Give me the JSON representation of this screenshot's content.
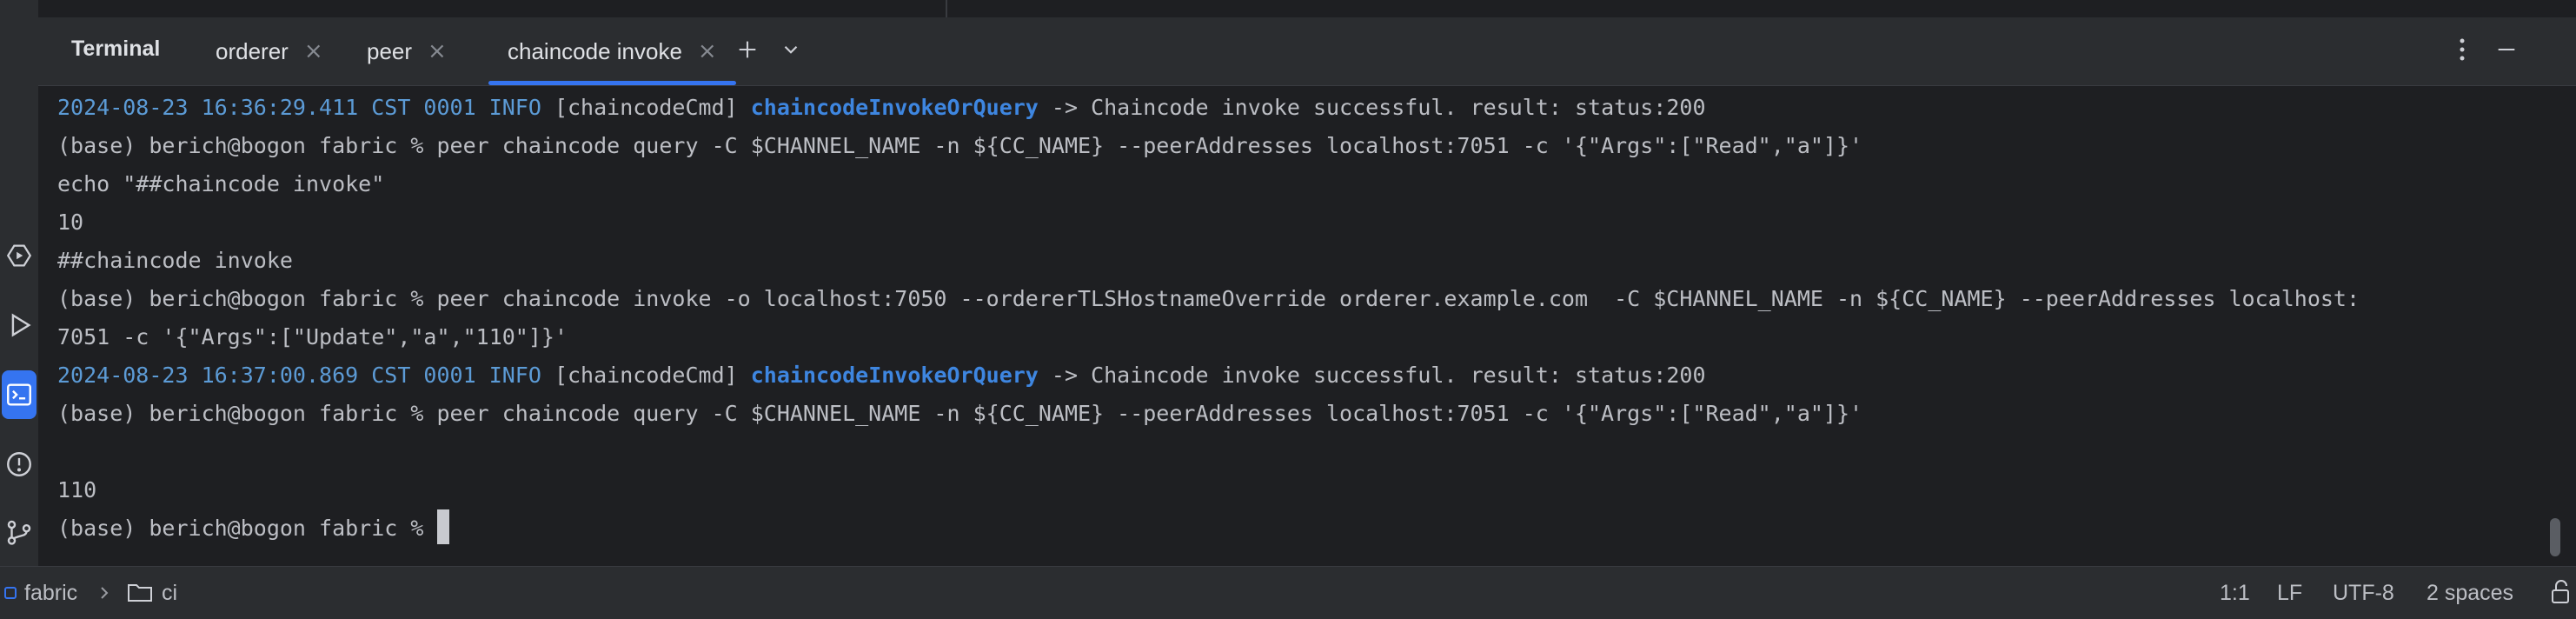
{
  "tool_window": {
    "title": "Terminal",
    "tabs": [
      {
        "label": "orderer",
        "active": false
      },
      {
        "label": "peer",
        "active": false
      },
      {
        "label": "chaincode invoke",
        "active": true
      }
    ],
    "actions": [
      "new-tab",
      "tab-options",
      "more-options",
      "minimize"
    ]
  },
  "left_toolbar": {
    "items": [
      "services",
      "run",
      "terminal",
      "problems",
      "git"
    ],
    "active": "terminal"
  },
  "terminal": {
    "lines": [
      {
        "ts": "2024-08-23 16:36:29.411 CST 0001 INFO",
        "mid": " [chaincodeCmd] ",
        "fn": "chaincodeInvokeOrQuery",
        "rest": " -> Chaincode invoke successful. result: status:200"
      },
      {
        "text": "(base) berich@bogon fabric % peer chaincode query -C $CHANNEL_NAME -n ${CC_NAME} --peerAddresses localhost:7051 -c '{\"Args\":[\"Read\",\"a\"]}'"
      },
      {
        "text": "echo \"##chaincode invoke\""
      },
      {
        "text": "10"
      },
      {
        "text": "##chaincode invoke"
      },
      {
        "text": "(base) berich@bogon fabric % peer chaincode invoke -o localhost:7050 --ordererTLSHostnameOverride orderer.example.com  -C $CHANNEL_NAME -n ${CC_NAME} --peerAddresses localhost:"
      },
      {
        "text": "7051 -c '{\"Args\":[\"Update\",\"a\",\"110\"]}'"
      },
      {
        "ts": "2024-08-23 16:37:00.869 CST 0001 INFO",
        "mid": " [chaincodeCmd] ",
        "fn": "chaincodeInvokeOrQuery",
        "rest": " -> Chaincode invoke successful. result: status:200"
      },
      {
        "text": "(base) berich@bogon fabric % peer chaincode query -C $CHANNEL_NAME -n ${CC_NAME} --peerAddresses localhost:7051 -c '{\"Args\":[\"Read\",\"a\"]}'"
      },
      {
        "text": ""
      },
      {
        "text": "110"
      },
      {
        "text": "(base) berich@bogon fabric % "
      }
    ]
  },
  "statusbar": {
    "breadcrumb": [
      "fabric",
      "ci"
    ],
    "position": "1:1",
    "line_ending": "LF",
    "encoding": "UTF-8",
    "indent": "2 spaces"
  },
  "colors": {
    "accent": "#3574f0",
    "timestamp": "#5c9bd6",
    "function_name": "#3e86e0",
    "background": "#1e1f22"
  }
}
